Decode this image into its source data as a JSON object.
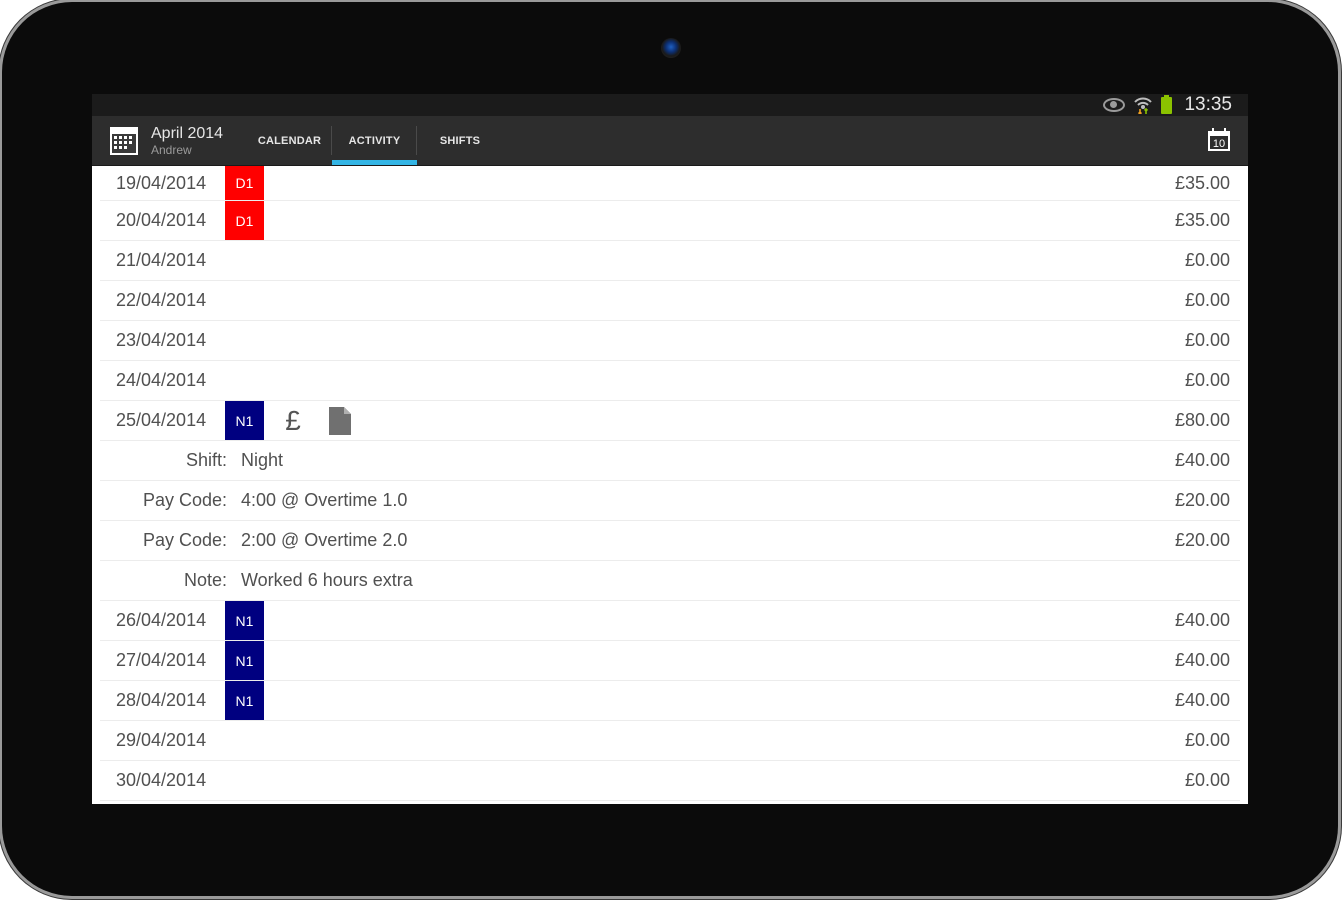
{
  "status_bar": {
    "time": "13:35",
    "icons": [
      "eye-icon",
      "wifi-icon",
      "battery-icon"
    ],
    "battery_color": "#8bc200"
  },
  "action_bar": {
    "title": "April 2014",
    "subtitle": "Andrew",
    "tabs": [
      {
        "label": "CALENDAR",
        "active": false
      },
      {
        "label": "ACTIVITY",
        "active": true
      },
      {
        "label": "SHIFTS",
        "active": false
      }
    ],
    "today_button_day": "10",
    "accent_color": "#33b5e5"
  },
  "colors": {
    "D1": "#ff0000",
    "N1": "#000080"
  },
  "rows": [
    {
      "type": "day",
      "date": "19/04/2014",
      "shift": "D1",
      "amount": "£35.00"
    },
    {
      "type": "day",
      "date": "20/04/2014",
      "shift": "D1",
      "amount": "£35.00"
    },
    {
      "type": "day",
      "date": "21/04/2014",
      "shift": "",
      "amount": "£0.00"
    },
    {
      "type": "day",
      "date": "22/04/2014",
      "shift": "",
      "amount": "£0.00"
    },
    {
      "type": "day",
      "date": "23/04/2014",
      "shift": "",
      "amount": "£0.00"
    },
    {
      "type": "day",
      "date": "24/04/2014",
      "shift": "",
      "amount": "£0.00"
    },
    {
      "type": "day",
      "date": "25/04/2014",
      "shift": "N1",
      "has_pay": true,
      "has_note": true,
      "pay_icon": "£",
      "amount": "£80.00"
    },
    {
      "type": "detail",
      "label": "Shift:",
      "value": "Night",
      "amount": "£40.00"
    },
    {
      "type": "detail",
      "label": "Pay Code:",
      "value": "4:00 @ Overtime 1.0",
      "amount": "£20.00"
    },
    {
      "type": "detail",
      "label": "Pay Code:",
      "value": "2:00 @ Overtime 2.0",
      "amount": "£20.00"
    },
    {
      "type": "detail",
      "label": "Note:",
      "value": "Worked 6 hours extra",
      "amount": ""
    },
    {
      "type": "day",
      "date": "26/04/2014",
      "shift": "N1",
      "amount": "£40.00"
    },
    {
      "type": "day",
      "date": "27/04/2014",
      "shift": "N1",
      "amount": "£40.00"
    },
    {
      "type": "day",
      "date": "28/04/2014",
      "shift": "N1",
      "amount": "£40.00"
    },
    {
      "type": "day",
      "date": "29/04/2014",
      "shift": "",
      "amount": "£0.00"
    },
    {
      "type": "day",
      "date": "30/04/2014",
      "shift": "",
      "amount": "£0.00"
    }
  ]
}
